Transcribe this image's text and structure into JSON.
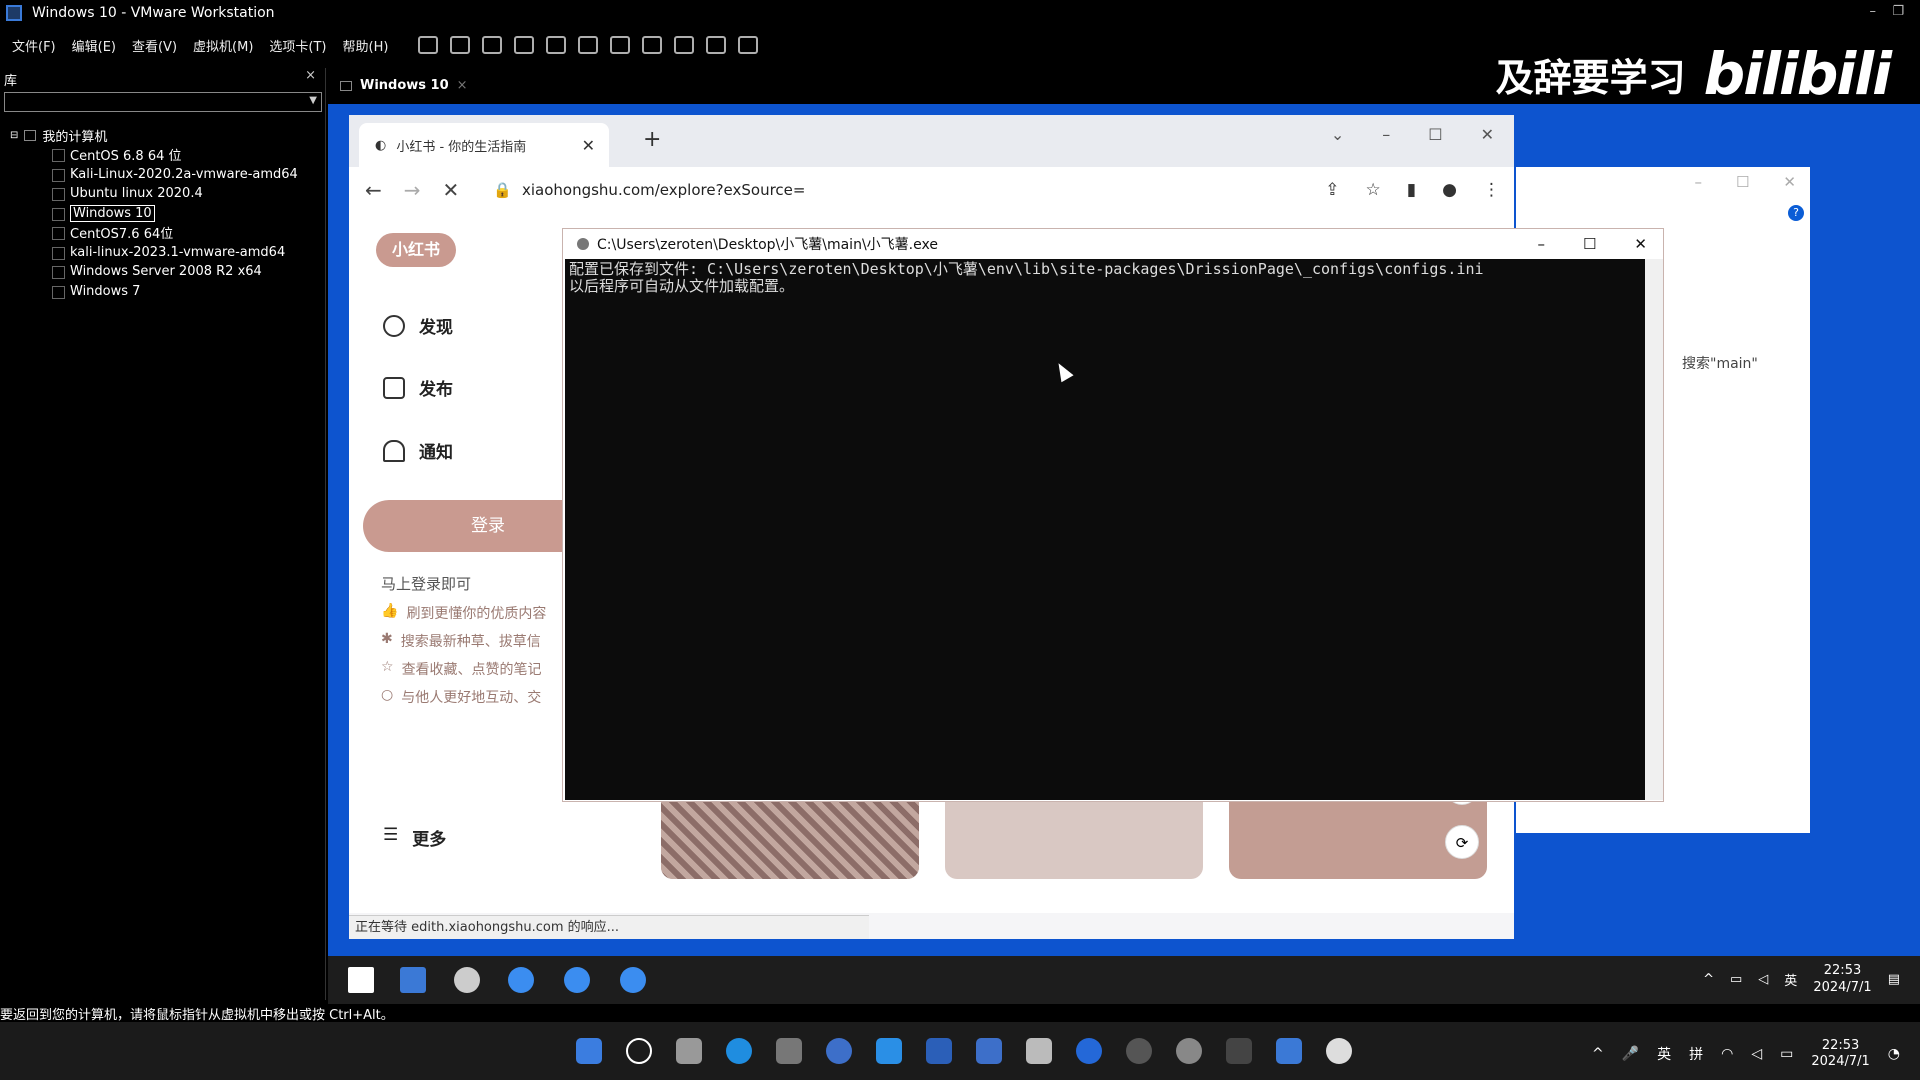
{
  "vm": {
    "title": "Windows 10 - VMware Workstation",
    "menu": [
      "文件(F)",
      "编辑(E)",
      "查看(V)",
      "虚拟机(M)",
      "选项卡(T)",
      "帮助(H)"
    ],
    "library": {
      "header": "库",
      "close": "×",
      "root": "我的计算机",
      "items": [
        "CentOS 6.8 64 位",
        "Kali-Linux-2020.2a-vmware-amd64",
        "Ubuntu linux 2020.4",
        "Windows 10",
        "CentOS7.6 64位",
        "kali-linux-2023.1-vmware-amd64",
        "Windows Server 2008 R2 x64",
        "Windows 7"
      ],
      "selected": "Windows 10"
    },
    "tab": "Windows 10",
    "status": "要返回到您的计算机，请将鼠标指针从虚拟机中移出或按 Ctrl+Alt。"
  },
  "watermark": {
    "text": "及辞要学习",
    "logo": "bilibili"
  },
  "browser": {
    "tab_title": "小红书 - 你的生活指南",
    "url": "xiaohongshu.com/explore?exSource=",
    "logo": "小红书",
    "nav": [
      "发现",
      "发布",
      "通知"
    ],
    "login": "登录",
    "login_tip": "马上登录即可",
    "benefits": [
      "刷到更懂你的优质内容",
      "搜索最新种草、拔草信",
      "查看收藏、点赞的笔记",
      "与他人更好地互动、交"
    ],
    "more": "更多",
    "status": "正在等待 edith.xiaohongshu.com 的响应..."
  },
  "explorer": {
    "search": "搜索\"main\""
  },
  "console": {
    "title": "C:\\Users\\zeroten\\Desktop\\小飞薯\\main\\小飞薯.exe",
    "line1": "配置已保存到文件: C:\\Users\\zeroten\\Desktop\\小飞薯\\env\\lib\\site-packages\\DrissionPage\\_configs\\configs.ini",
    "line2": "以后程序可自动从文件加载配置。"
  },
  "guest_clock": {
    "time": "22:53",
    "date": "2024/7/1"
  },
  "host_clock": {
    "time": "22:53",
    "date": "2024/7/1"
  },
  "host_tray": {
    "lang": "英",
    "ime": "拼"
  },
  "guest_tray": {
    "lang": "英"
  }
}
